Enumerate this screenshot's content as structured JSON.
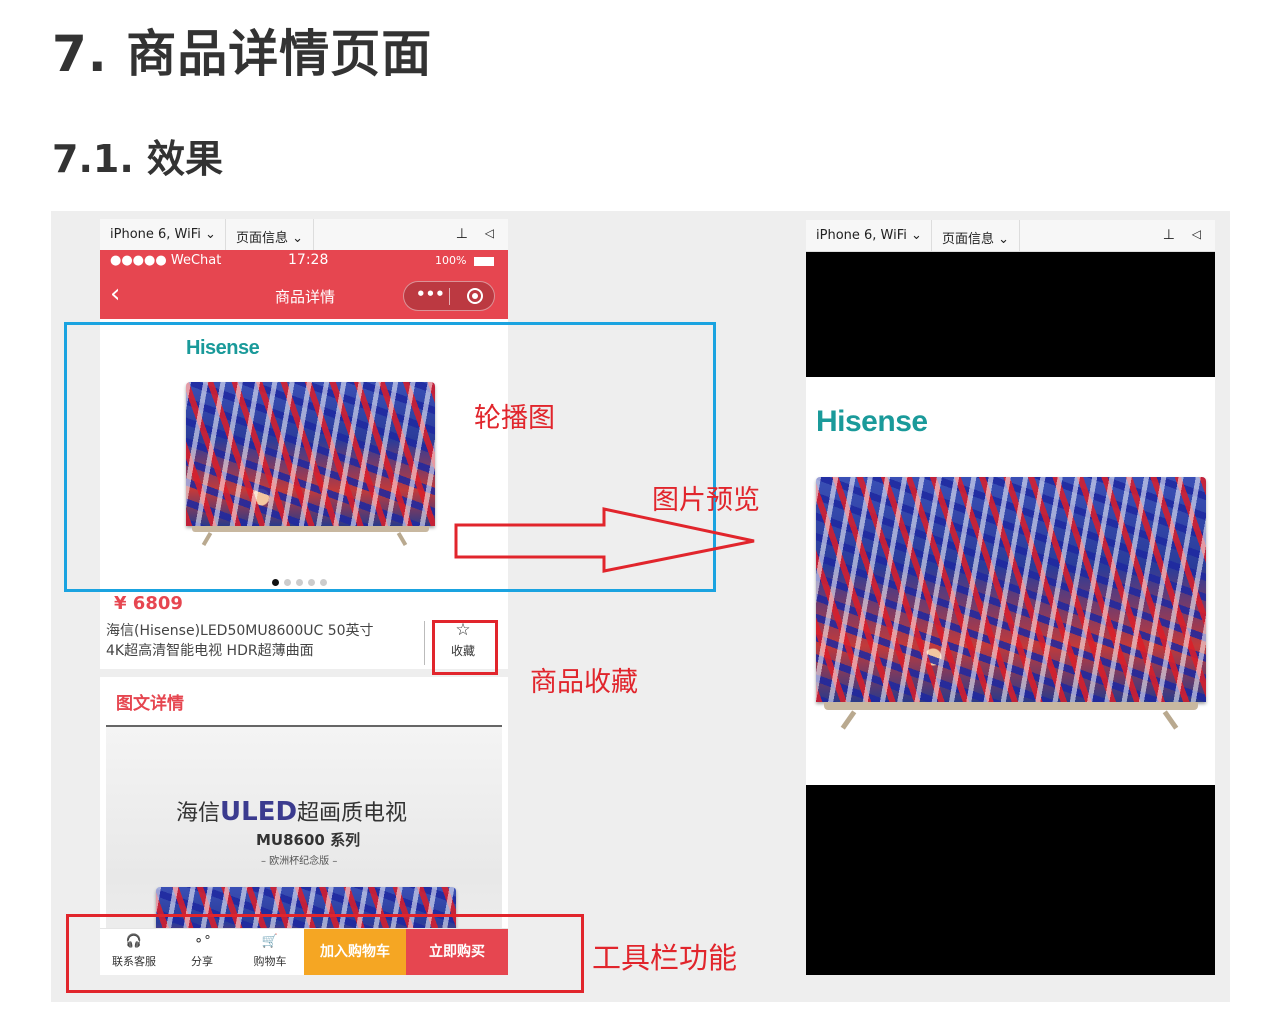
{
  "doc": {
    "heading": "7. 商品详情页面",
    "subheading": "7.1. 效果"
  },
  "simulator": {
    "device": "iPhone 6, WiFi",
    "page_info": "页面信息",
    "pin_icon": "pin-icon",
    "sound_icon": "speaker-icon"
  },
  "status_bar": {
    "carrier": "●●●●● WeChat",
    "time": "17:28",
    "battery": "100%"
  },
  "nav": {
    "title": "商品详情",
    "more": "•••"
  },
  "product": {
    "brand": "Hisense",
    "price": "¥ 6809",
    "name_line1": "海信(Hisense)LED50MU8600UC 50英寸",
    "name_line2": "4K超高清智能电视 HDR超薄曲面",
    "favorite_label": "收藏",
    "details_heading": "图文详情",
    "poster_title_prefix": "海信",
    "poster_title_brand": "ULED",
    "poster_title_suffix": "超画质电视",
    "poster_series": "MU8600 系列",
    "poster_edition": "– 欧洲杯纪念版 –",
    "carousel_count": 5,
    "carousel_active": 1
  },
  "toolbar": {
    "contact": "联系客服",
    "share": "分享",
    "cart": "购物车",
    "add_to_cart": "加入购物车",
    "buy_now": "立即购买"
  },
  "annotations": {
    "carousel": "轮播图",
    "preview": "图片预览",
    "favorite": "商品收藏",
    "toolbar": "工具栏功能"
  },
  "colors": {
    "nav_red": "#e64650",
    "annotation_red": "#e1252c",
    "carousel_box_blue": "#1aa3e0",
    "add_cart_orange": "#f5a623",
    "buy_now_red": "#e64650",
    "brand_teal": "#1a9a9a"
  }
}
